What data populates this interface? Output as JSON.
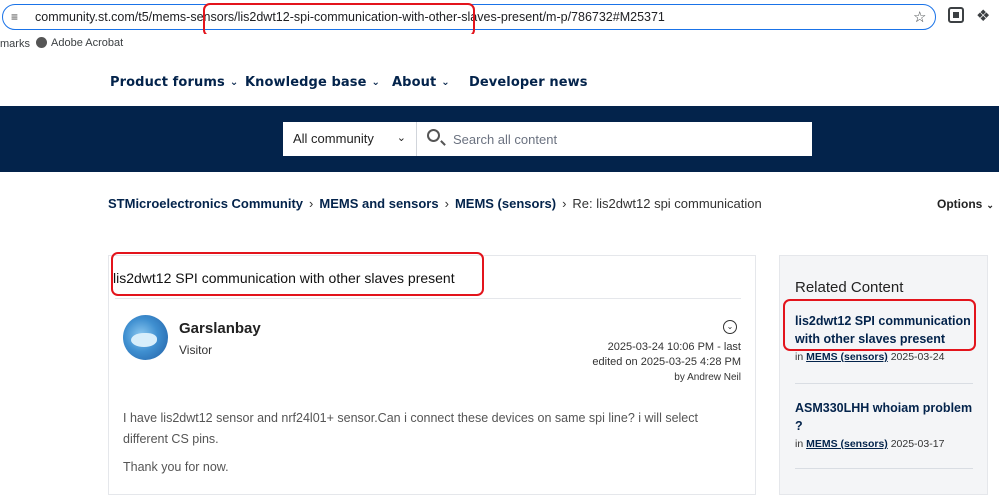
{
  "browser": {
    "url_prefix": "community.st.com/t5/mems-sensors/",
    "url_highlight": "lis2dwt12-spi-communication-with-other-slaves-present/",
    "url_suffix": "m-p/786732#M25371",
    "bookmarks_label": "marks",
    "bookmark_acrobat": "Adobe Acrobat"
  },
  "nav": {
    "items": [
      {
        "label": "Product forums"
      },
      {
        "label": "Knowledge base"
      },
      {
        "label": "About"
      },
      {
        "label": "Developer news"
      }
    ]
  },
  "search": {
    "scope": "All community",
    "placeholder": "Search all content"
  },
  "breadcrumb": {
    "items": [
      "STMicroelectronics Community",
      "MEMS and sensors",
      "MEMS (sensors)"
    ],
    "current": "Re: lis2dwt12 spi communication",
    "options_label": "Options"
  },
  "post": {
    "title": "lis2dwt12 SPI communication with other slaves present",
    "author": "Garslanbay",
    "rank": "Visitor",
    "date": "2025-03-24 10:06 PM",
    "edit_prefix": " - last",
    "edited_on": "edited on 2025-03-25 4:28 PM",
    "edited_by": "by Andrew Neil",
    "body": [
      "I have lis2dwt12 sensor and nrf24l01+ sensor.Can i connect these devices on same spi line? i will select different CS pins.",
      "Thank you for now."
    ]
  },
  "related": {
    "heading": "Related Content",
    "items": [
      {
        "title": "lis2dwt12 SPI communication with other slaves present",
        "in": "in ",
        "board": "MEMS (sensors)",
        "date": " 2025-03-24"
      },
      {
        "title": "ASM330LHH whoiam problem ?",
        "in": "in ",
        "board": "MEMS (sensors)",
        "date": " 2025-03-17"
      }
    ]
  }
}
